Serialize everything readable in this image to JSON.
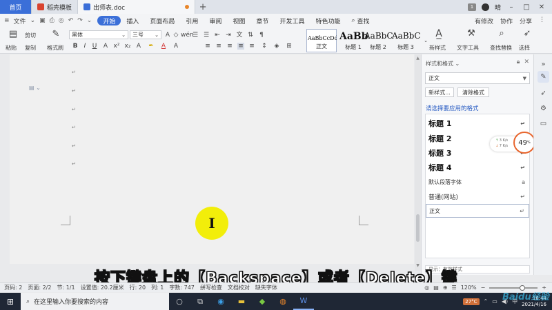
{
  "tabbar": {
    "home_tab": "首页",
    "template_tab": "稻壳模板",
    "doc_tab": "出师表.doc",
    "add_tab": "+",
    "badge": "1",
    "user_name": "晴"
  },
  "menubar": {
    "file_label": "文件",
    "tabs": [
      "开始",
      "插入",
      "页面布局",
      "引用",
      "审阅",
      "视图",
      "章节",
      "开发工具",
      "特色功能"
    ],
    "search_label": "查找",
    "right_items": [
      "有修改",
      "协作",
      "分享"
    ]
  },
  "ribbon": {
    "paste": "粘贴",
    "cut": "剪切",
    "copy": "复制",
    "format_painter": "格式刷",
    "font_name": "黑体",
    "font_size": "三号",
    "styles": [
      {
        "preview": "AaBbCcDd",
        "label": "正文"
      },
      {
        "preview": "AaBb",
        "label": "标题 1"
      },
      {
        "preview": "AaBbC",
        "label": "标题 2"
      },
      {
        "preview": "AaBbC",
        "label": "标题 3"
      }
    ],
    "new_style": "新样式",
    "text_tools": "文字工具",
    "find_replace": "查找替换",
    "select": "选择"
  },
  "styles_panel": {
    "title": "样式和格式",
    "current_style": "正文",
    "new_style_btn": "新样式...",
    "clear_format_btn": "清除格式",
    "hint": "请选择要应用的格式",
    "items": [
      {
        "label": "标题 1",
        "kind": "h"
      },
      {
        "label": "标题 2",
        "kind": "h"
      },
      {
        "label": "标题 3",
        "kind": "h"
      },
      {
        "label": "标题 4",
        "kind": "h"
      },
      {
        "label": "默认段落字体",
        "kind": "small"
      },
      {
        "label": "普通(网站)",
        "kind": "small"
      },
      {
        "label": "正文",
        "kind": "small"
      }
    ],
    "show_label": "显示：有效样式"
  },
  "speed_widget": {
    "up": "3",
    "down": "7",
    "unit": "K/s",
    "percent": "49",
    "percent_sign": "%"
  },
  "subtitle": "按下键盘上的【Backspace】或者【Delete】键",
  "statusbar": {
    "page": "页码: 2",
    "pages": "页面: 2/2",
    "section": "节: 1/1",
    "setting": "设置值: 20.2厘米",
    "row": "行: 20",
    "col": "列: 1",
    "words": "字数: 747",
    "spell": "拼写检查",
    "doc_check": "文档校对",
    "missing_font": "缺失字体",
    "zoom": "120%"
  },
  "taskbar": {
    "search_placeholder": "在这里输入你要搜索的内容",
    "tray_item": "27°C",
    "time": "16:44",
    "date": "2021/4/16"
  },
  "watermark": "Baidu经验"
}
